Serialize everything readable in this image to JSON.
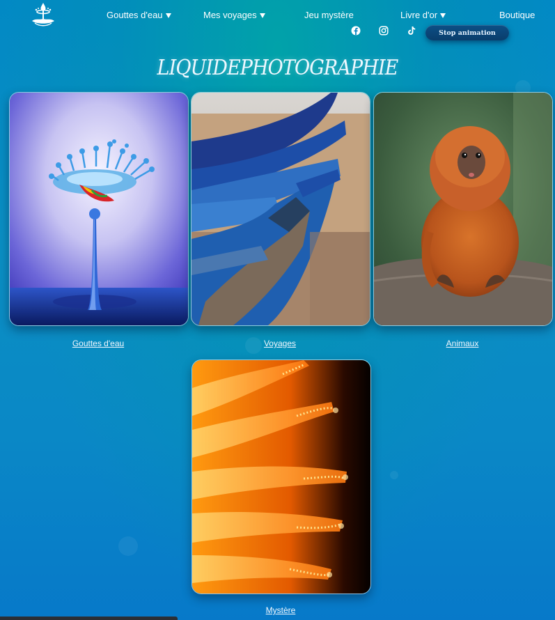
{
  "nav": {
    "items": [
      {
        "label": "Gouttes d'eau",
        "has_dropdown": true
      },
      {
        "label": "Mes voyages",
        "has_dropdown": true
      },
      {
        "label": "Jeu mystère",
        "has_dropdown": false
      },
      {
        "label": "Livre d'or",
        "has_dropdown": true
      },
      {
        "label": "Boutique",
        "has_dropdown": false
      }
    ]
  },
  "social": [
    "facebook-icon",
    "instagram-icon",
    "tiktok-icon"
  ],
  "stop_button": {
    "label": "Stop animation"
  },
  "site_title": "LIQUIDEPHOTOGRAPHIE",
  "gallery": [
    {
      "caption": "Gouttes d'eau",
      "image": "water-drop-splash"
    },
    {
      "caption": "Voyages",
      "image": "blue-wooden-boats"
    },
    {
      "caption": "Animaux",
      "image": "golden-lion-tamarin"
    },
    {
      "caption": "Mystère",
      "image": "orange-flower-macro"
    }
  ],
  "colors": {
    "background": "#0a88c6",
    "accent": "#0a3d6b",
    "text": "#ffffff"
  }
}
